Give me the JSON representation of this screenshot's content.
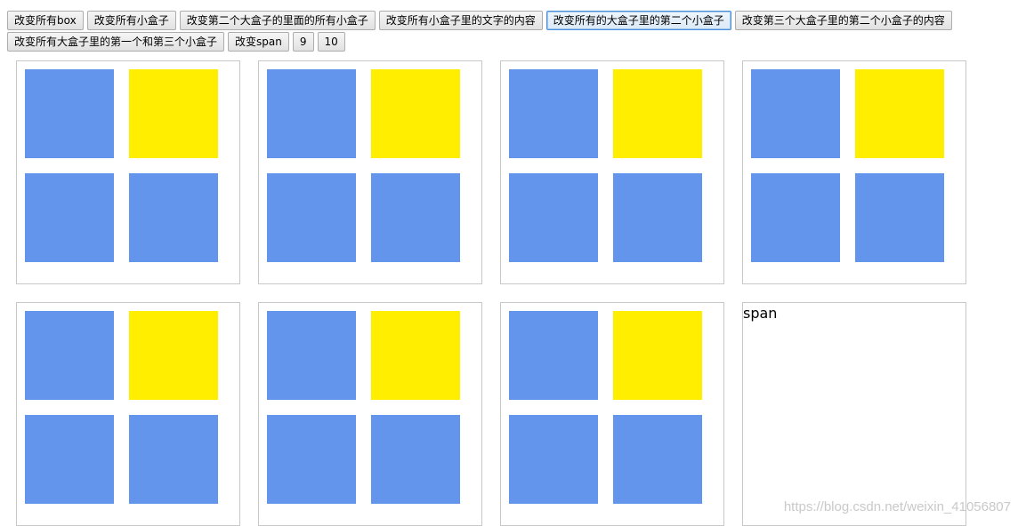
{
  "buttons_row1": [
    "改变所有box",
    "改变所有小盒子",
    "改变第二个大盒子的里面的所有小盒子",
    "改变所有小盒子里的文字的内容",
    "改变所有的大盒子里的第二个小盒子",
    "改变第三个大盒子里的第二个小盒子的内容"
  ],
  "buttons_row2": [
    "改变所有大盒子里的第一个和第三个小盒子",
    "改变span",
    "9",
    "10"
  ],
  "colors": {
    "small_box_default": "#6495ed",
    "small_box_second": "#ffee00",
    "box_border": "#c8c8c8"
  },
  "span_box": {
    "text": "span"
  },
  "watermark": "https://blog.csdn.net/weixin_41056807"
}
